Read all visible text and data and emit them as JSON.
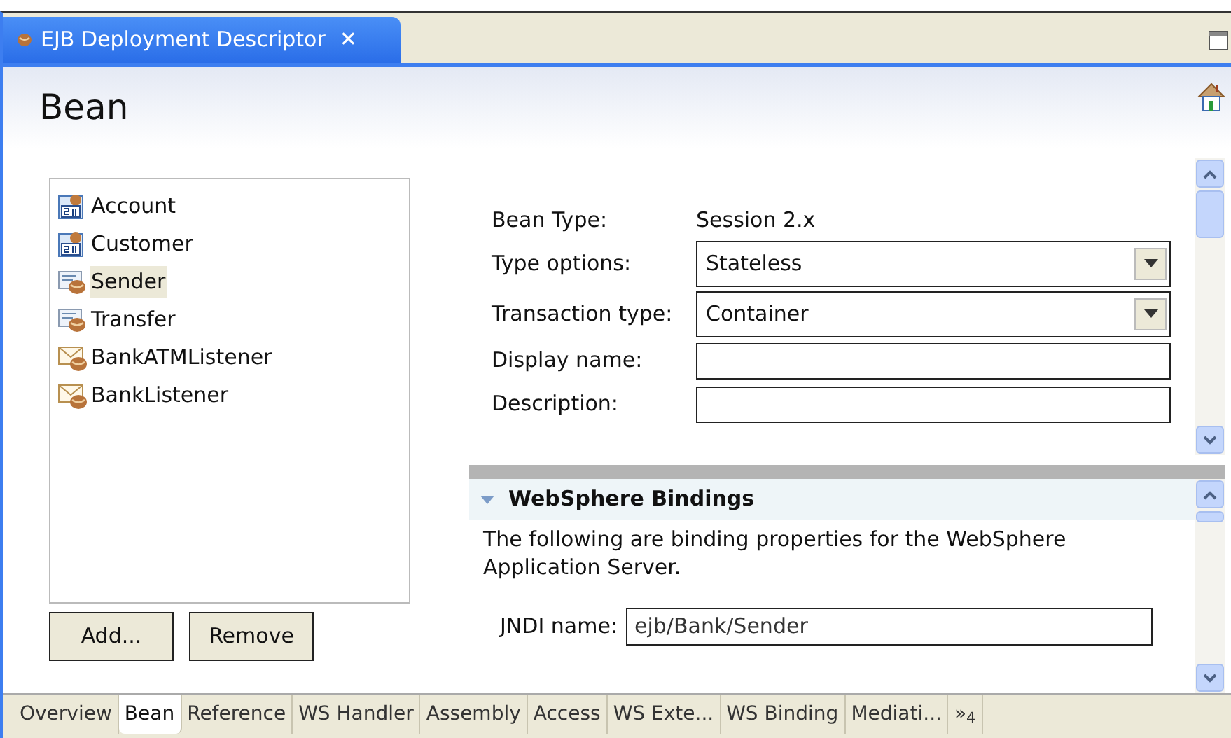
{
  "editor_tab": {
    "title": "EJB Deployment Descriptor",
    "close": "✕"
  },
  "page_title": "Bean",
  "beans": [
    {
      "name": "Account",
      "kind": "entity",
      "selected": false
    },
    {
      "name": "Customer",
      "kind": "entity",
      "selected": false
    },
    {
      "name": "Sender",
      "kind": "session",
      "selected": true
    },
    {
      "name": "Transfer",
      "kind": "session",
      "selected": false
    },
    {
      "name": "BankATMListener",
      "kind": "message",
      "selected": false
    },
    {
      "name": "BankListener",
      "kind": "message",
      "selected": false
    }
  ],
  "list_buttons": [
    "Add...",
    "Remove"
  ],
  "form": [
    {
      "label": "Bean Type:",
      "kind": "text",
      "value": "Session 2.x"
    },
    {
      "label": "Type options:",
      "kind": "select",
      "value": "Stateless"
    },
    {
      "label": "Transaction type:",
      "kind": "select",
      "value": "Container"
    },
    {
      "label": "Display name:",
      "kind": "input"
    },
    {
      "label": "Description:",
      "kind": "input"
    }
  ],
  "bindings": {
    "title": "WebSphere Bindings",
    "expanded": true,
    "description": "The following are binding properties for the WebSphere Application Server.",
    "jndi_label": "JNDI name:",
    "jndi_value": "ejb/Bank/Sender"
  },
  "bottom_tabs": [
    {
      "label": "Overview",
      "selected": false
    },
    {
      "label": "Bean",
      "selected": true
    },
    {
      "label": "Reference",
      "selected": false
    },
    {
      "label": "WS Handler",
      "selected": false
    },
    {
      "label": "Assembly",
      "selected": false
    },
    {
      "label": "Access",
      "selected": false
    },
    {
      "label": "WS Exte...",
      "selected": false
    },
    {
      "label": "WS Binding",
      "selected": false
    },
    {
      "label": "Mediati...",
      "selected": false
    },
    {
      "label": "»$_{4}$",
      "selected": false
    }
  ]
}
